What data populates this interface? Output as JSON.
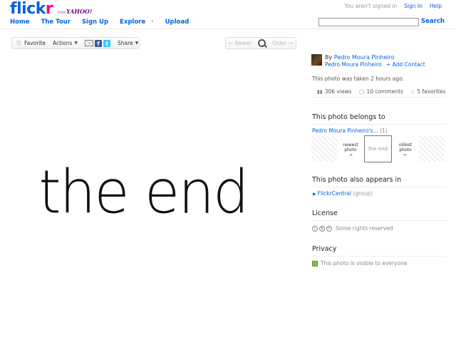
{
  "header": {
    "logo_part1": "flick",
    "logo_part2": "r",
    "from_text": "from",
    "yahoo": "YAHOO!",
    "not_signed_in": "You aren't signed in",
    "sign_in": "Sign In",
    "help": "Help",
    "nav": [
      "Home",
      "The Tour",
      "Sign Up",
      "Explore",
      "Upload"
    ],
    "search_button": "Search"
  },
  "toolbar": {
    "favorite": "Favorite",
    "actions": "Actions",
    "share": "Share",
    "newer": "Newer",
    "older": "Older"
  },
  "photo": {
    "text": "the end"
  },
  "sidebar": {
    "by": "By",
    "owner": "Pedro Moura Pinheiro",
    "owner_name": "Pedro Moura Pinheiro",
    "add_contact": "+ Add Contact",
    "taken": "This photo was taken 2 hours ago.",
    "views": "306 views",
    "comments": "10 comments",
    "favorites": "5 favorites",
    "belongs_title": "This photo belongs to",
    "photostream": "Pedro Moura Pinheiro's...",
    "photostream_count": "(1)",
    "newest": "newest",
    "oldest": "oldest",
    "photo_word": "photo",
    "thumb_text": "the end",
    "appears_title": "This photo also appears in",
    "group": "FlickrCentral",
    "group_suffix": "(group)",
    "license_title": "License",
    "license_text": "Some rights reserved",
    "privacy_title": "Privacy",
    "privacy_text": "This photo is visible to everyone"
  },
  "colors": {
    "link": "#0063dc",
    "brand_pink": "#ff0084",
    "yahoo_purple": "#7b0099"
  }
}
